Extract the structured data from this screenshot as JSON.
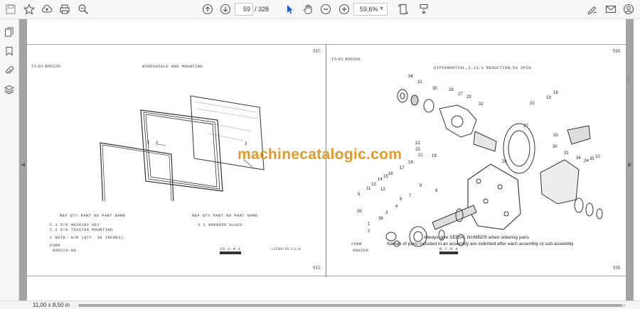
{
  "toolbar": {
    "icons": [
      "save-icon",
      "bookmark-star-icon",
      "upload-icon",
      "print-icon",
      "zoom-search-icon",
      "page-up-icon",
      "page-down-icon",
      "select-arrow-icon",
      "hand-icon",
      "zoom-out-icon",
      "zoom-in-icon",
      "fit-page-icon",
      "scroll-mode-icon",
      "edit-sign-icon",
      "mail-icon",
      "account-icon"
    ],
    "page_current": "59",
    "page_total": "/ 328",
    "zoom": "59,6%"
  },
  "left_rail": {
    "icons": [
      "pages-icon",
      "bookmark-icon",
      "attachment-icon",
      "layers-icon"
    ]
  },
  "document": {
    "watermark": "machinecatalogic.com",
    "left_page": {
      "header_code": "15-01  800226",
      "header_title": "WINDSHIELD AND MOUNTING",
      "page_number_top": "915",
      "page_number_bottom": "915",
      "callouts": [
        "1",
        "2",
        "3"
      ],
      "table_header": "REF   QTY   PART NO   PART NAME",
      "table_rows": [
        "C     1  5/6   4026181   KEY",
        "C     2  5/6   755676A   MOUNTING"
      ],
      "table_header_right": "REF   QTY   PART NO   PART NAME",
      "table_row_right": "3     1   4000656   GLASS",
      "note": "C  NOTE- A/R (QTY. IN INCHES).",
      "form_label": "FORM",
      "form_code": "800226-86",
      "ref_code": "15-1-4-1",
      "litho": "LITHO IN U.S.A."
    },
    "right_page": {
      "header_code": "15-01  800266",
      "header_title": "DIFFERENTIAL,3.13.1 REDUCTION,50 SPIN",
      "page_number_top": "916",
      "page_number_bottom": "916",
      "callouts": [
        "34",
        "31",
        "30",
        "28",
        "29",
        "27",
        "32",
        "19",
        "18",
        "20",
        "33",
        "27",
        "30",
        "31",
        "34",
        "24",
        "35",
        "10",
        "26",
        "22",
        "23",
        "21",
        "19",
        "18",
        "17",
        "16",
        "15",
        "14",
        "13",
        "11",
        "12",
        "9",
        "8",
        "7",
        "6",
        "5",
        "4",
        "3",
        "35",
        "36",
        "1",
        "2"
      ],
      "note_line_1": "Always give SERIAL NUMBER when ordering parts",
      "note_line_2": "Names of parts included in an assembly are indented after each assembly or sub-assembly",
      "form_label": "FORM",
      "form_code": "800266",
      "ref_code": "8.7.0.4"
    }
  },
  "status_bar": {
    "page_size": "11,00 x 8,50 in"
  }
}
